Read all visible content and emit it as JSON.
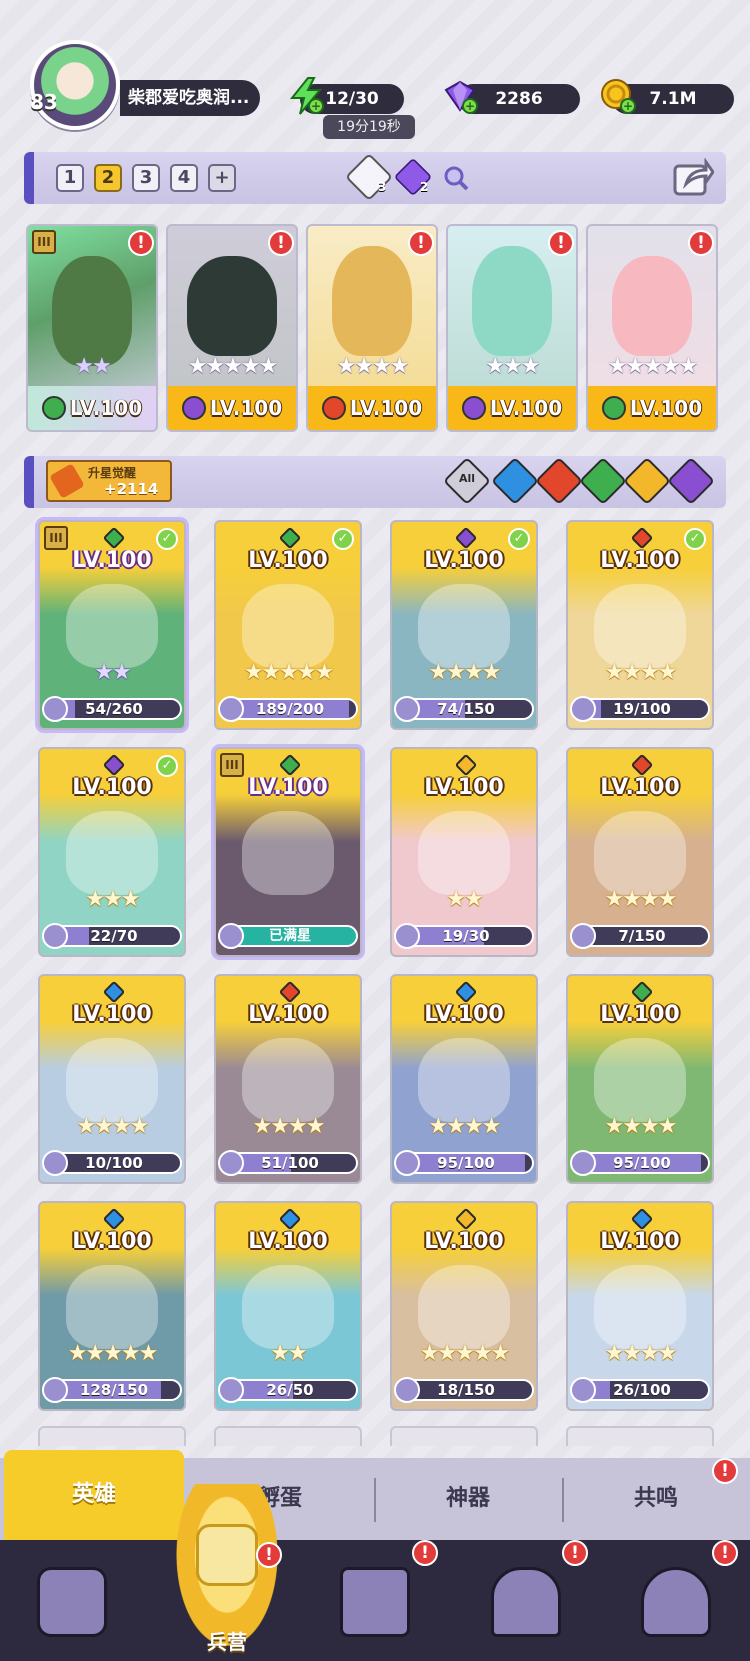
{
  "player": {
    "level": "83",
    "name": "柴郡爱吃奥润..."
  },
  "resources": {
    "energy": "12/30",
    "energy_timer": "19分19秒",
    "gems": "2286",
    "gold": "7.1M"
  },
  "teams": {
    "tabs": [
      "1",
      "2",
      "3",
      "4"
    ],
    "active": "2",
    "add_label": "+",
    "badge_white": "3",
    "badge_purple": "2"
  },
  "team_heroes": [
    {
      "level": "LV.100",
      "element": "nature",
      "stars": "★★",
      "star_color": "purple",
      "rank": "III",
      "alert": "!"
    },
    {
      "level": "LV.100",
      "element": "dark",
      "stars": "★★★★★",
      "star_color": "gold",
      "alert": "!"
    },
    {
      "level": "LV.100",
      "element": "fire",
      "stars": "★★★★",
      "star_color": "gold",
      "alert": "!"
    },
    {
      "level": "LV.100",
      "element": "dark",
      "stars": "★★★",
      "star_color": "gold",
      "alert": "!"
    },
    {
      "level": "LV.100",
      "element": "nature",
      "stars": "★★★★★",
      "star_color": "gold",
      "alert": "!"
    }
  ],
  "star_awaken": {
    "label": "升星觉醒",
    "value": "+2114"
  },
  "filters": {
    "all_label": "All",
    "elements": [
      "water",
      "fire",
      "nature",
      "light",
      "dark"
    ]
  },
  "heroes": [
    {
      "level": "LV.100",
      "element": "nature",
      "progress": "54/260",
      "stars": "★★",
      "purple": true,
      "rank": "III",
      "check": true,
      "bg": "#5fb27a"
    },
    {
      "level": "LV.100",
      "element": "nature",
      "progress": "189/200",
      "stars": "★★★★★",
      "check": true,
      "bg": "#f2c84a"
    },
    {
      "level": "LV.100",
      "element": "dark",
      "progress": "74/150",
      "stars": "★★★★",
      "check": true,
      "bg": "#8ab6c2"
    },
    {
      "level": "LV.100",
      "element": "fire",
      "progress": "19/100",
      "stars": "★★★★",
      "check": true,
      "bg": "#efd79a"
    },
    {
      "level": "LV.100",
      "element": "dark",
      "progress": "22/70",
      "stars": "★★★",
      "check": true,
      "bg": "#8fd4c4"
    },
    {
      "level": "LV.100",
      "element": "nature",
      "progress": "",
      "maxed": "已满星",
      "stars": "",
      "purple": true,
      "rank": "III",
      "bg": "#6b5a6e"
    },
    {
      "level": "LV.100",
      "element": "light",
      "progress": "19/30",
      "stars": "★★",
      "bg": "#f0c9cf"
    },
    {
      "level": "LV.100",
      "element": "fire",
      "progress": "7/150",
      "stars": "★★★★",
      "bg": "#d6b08f"
    },
    {
      "level": "LV.100",
      "element": "water",
      "progress": "10/100",
      "stars": "★★★★",
      "bg": "#b8cde2"
    },
    {
      "level": "LV.100",
      "element": "fire",
      "progress": "51/100",
      "stars": "★★★★",
      "bg": "#9a8a96"
    },
    {
      "level": "LV.100",
      "element": "water",
      "progress": "95/100",
      "stars": "★★★★",
      "bg": "#8fa2d0"
    },
    {
      "level": "LV.100",
      "element": "nature",
      "progress": "95/100",
      "stars": "★★★★",
      "bg": "#7fb873"
    },
    {
      "level": "LV.100",
      "element": "water",
      "progress": "128/150",
      "stars": "★★★★★",
      "bg": "#6f9aa8"
    },
    {
      "level": "LV.100",
      "element": "water",
      "progress": "26/50",
      "stars": "★★",
      "bg": "#7cc7d6"
    },
    {
      "level": "LV.100",
      "element": "light",
      "progress": "18/150",
      "stars": "★★★★★",
      "bg": "#d8bfa0"
    },
    {
      "level": "LV.100",
      "element": "water",
      "progress": "26/100",
      "stars": "★★★★",
      "bg": "#c8d8ea"
    }
  ],
  "subtabs": {
    "heroes": "英雄",
    "hatch": "孵蛋",
    "artifact": "神器",
    "resonance": "共鸣"
  },
  "nav": {
    "barracks": "兵营",
    "alert": "!"
  },
  "element_colors": {
    "nature": "#3fae4f",
    "dark": "#8a4fd0",
    "fire": "#e2462b",
    "water": "#2f8fe0",
    "light": "#f2b72a"
  }
}
